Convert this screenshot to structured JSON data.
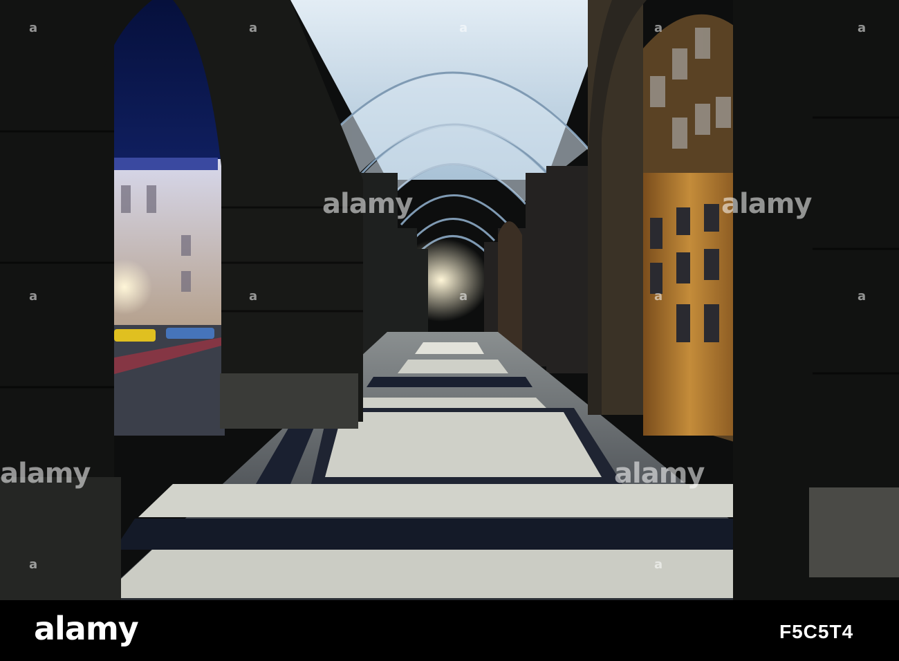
{
  "photo": {
    "subject": "Arched colonnade walkway with mosaic floor at night",
    "colors": {
      "sky": "#0a1a55",
      "vault": "#c9dcea",
      "stone": "#1c1d1c",
      "floor_light": "#cfd0c8",
      "floor_dark": "#1a2030",
      "door_wood": "#a8742e"
    }
  },
  "watermark": {
    "text": "alamy",
    "letter": "a"
  },
  "footer": {
    "brand": "alamy",
    "image_id": "F5C5T4"
  }
}
